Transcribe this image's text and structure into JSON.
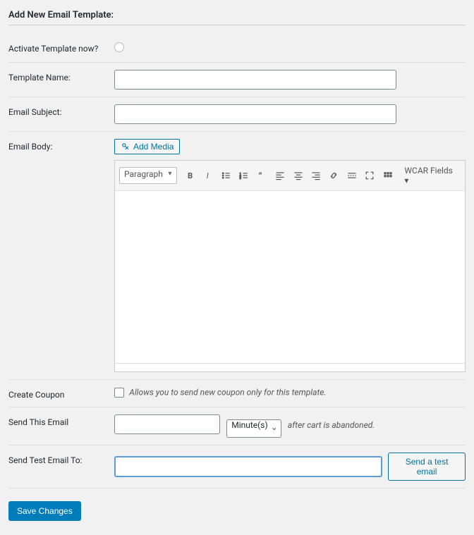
{
  "title": "Add New Email Template:",
  "labels": {
    "activate": "Activate Template now?",
    "template_name": "Template Name:",
    "email_subject": "Email Subject:",
    "email_body": "Email Body:",
    "create_coupon": "Create Coupon",
    "send_this_email": "Send This Email",
    "send_test_to": "Send Test Email To:"
  },
  "add_media_label": "Add Media",
  "editor": {
    "format": "Paragraph",
    "wcar_fields": "WCAR Fields ▾"
  },
  "create_coupon_help": "Allows you to send new coupon only for this template.",
  "send_units": "Minute(s)",
  "after_cart_text": "after cart is abandoned.",
  "send_test_btn": "Send a test email",
  "save_btn": "Save Changes",
  "inputs": {
    "template_name": "",
    "email_subject": "",
    "delay_number": "",
    "test_email": ""
  }
}
